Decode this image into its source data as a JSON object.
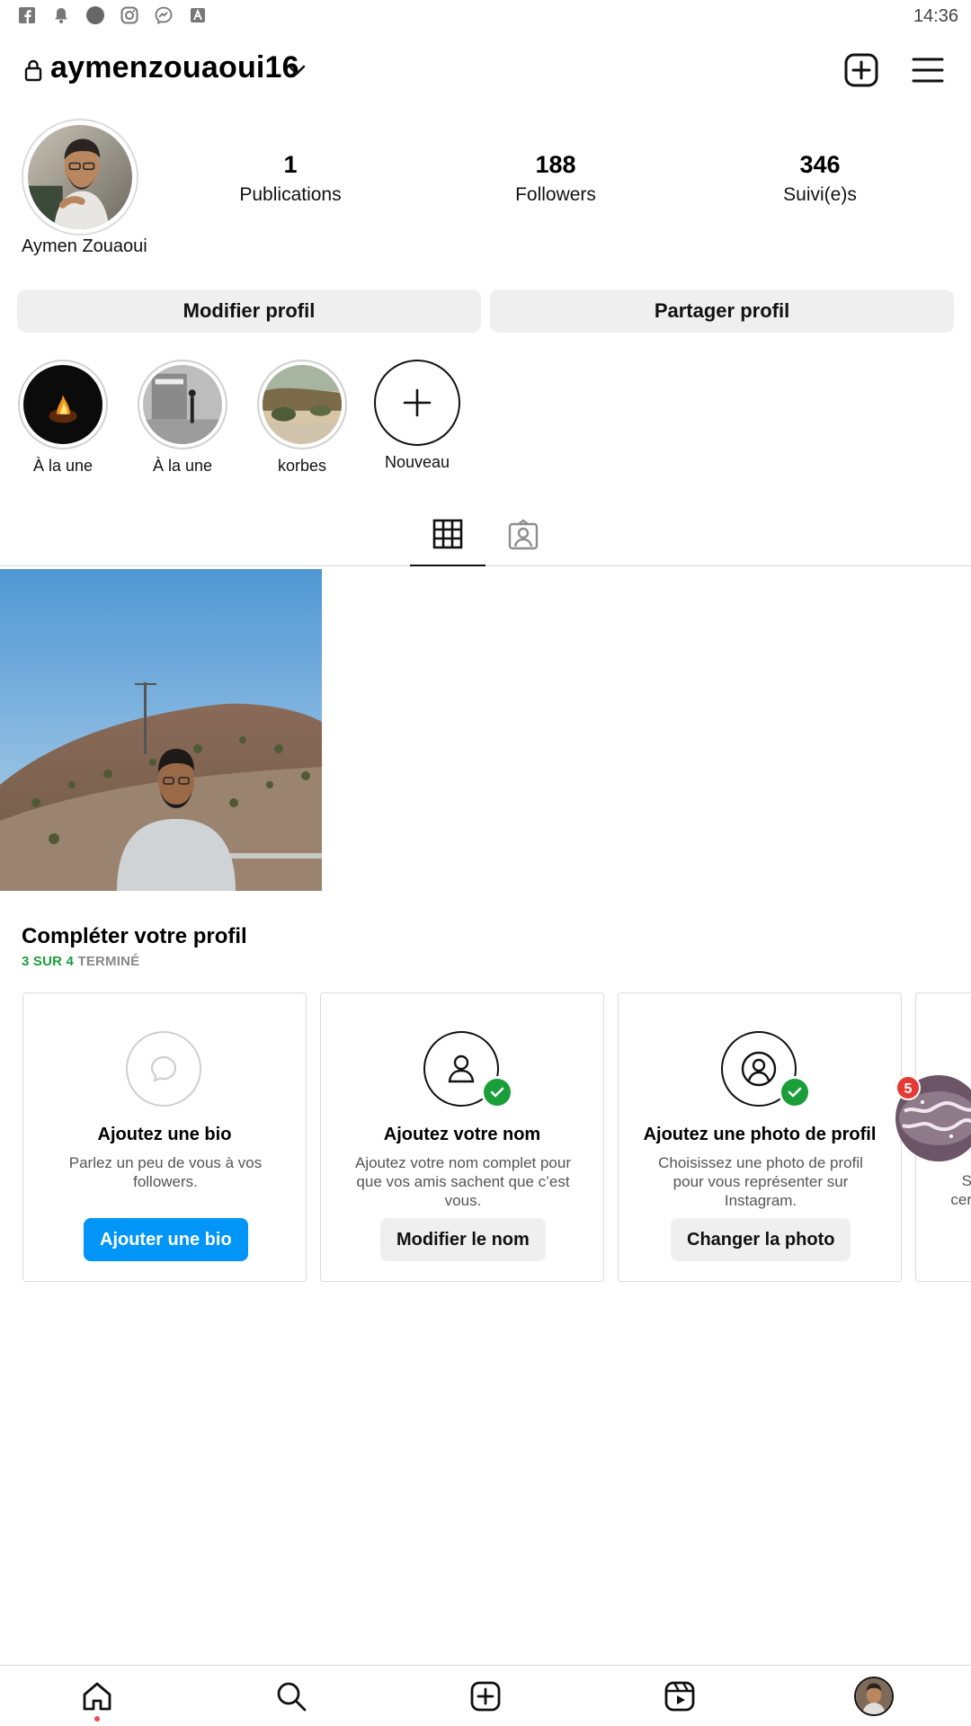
{
  "status_bar": {
    "time": "14:36",
    "icons": [
      "facebook-icon",
      "notification-bell-icon",
      "circle-icon",
      "instagram-icon",
      "messenger-icon",
      "font-a-icon"
    ]
  },
  "header": {
    "username": "aymenzouaoui16"
  },
  "profile": {
    "display_name": "Aymen Zouaoui",
    "stats": [
      {
        "value": "1",
        "label": "Publications"
      },
      {
        "value": "188",
        "label": "Followers"
      },
      {
        "value": "346",
        "label": "Suivi(e)s"
      }
    ],
    "edit_button": "Modifier profil",
    "share_button": "Partager profil"
  },
  "highlights": [
    {
      "label": "À la une"
    },
    {
      "label": "À la une"
    },
    {
      "label": "korbes"
    },
    {
      "label": "Nouveau"
    }
  ],
  "complete_profile": {
    "title": "Compléter votre profil",
    "progress_done": "3 SUR 4",
    "progress_suffix": " TERMINÉ",
    "cards": [
      {
        "title": "Ajoutez une bio",
        "description": "Parlez un peu de vous à vos followers.",
        "button": "Ajouter une bio"
      },
      {
        "title": "Ajoutez votre nom",
        "description": "Ajoutez votre nom complet pour que vos amis sachent que c’est vous.",
        "button": "Modifier le nom"
      },
      {
        "title": "Ajoutez une photo de profil",
        "description": "Choisissez une photo de profil pour vous représenter sur Instagram.",
        "button": "Changer la photo"
      }
    ],
    "partial_card_text": "S cer"
  },
  "chat_bubble": {
    "badge": "5"
  },
  "colors": {
    "accent": "#0095f6",
    "success": "#1a9e3a",
    "badge": "#e53935"
  }
}
